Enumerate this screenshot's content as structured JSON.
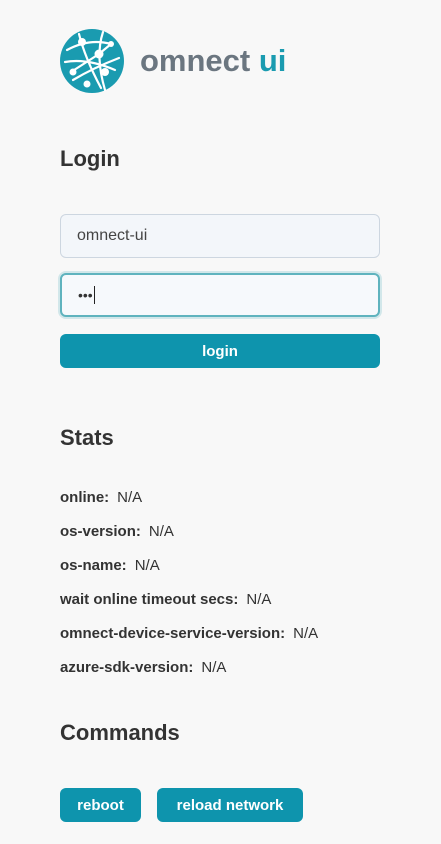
{
  "brand": {
    "name": "omnect",
    "accent": "ui",
    "logo_icon": "globe-network-icon",
    "colors": {
      "accent": "#1a9bb0",
      "name": "#6b7680"
    }
  },
  "login": {
    "title": "Login",
    "username_value": "omnect-ui",
    "password_mask": "•••",
    "button_label": "login"
  },
  "stats": {
    "title": "Stats",
    "items": [
      {
        "key": "online:",
        "value": "N/A"
      },
      {
        "key": "os-version:",
        "value": "N/A"
      },
      {
        "key": "os-name:",
        "value": "N/A"
      },
      {
        "key": "wait online timeout secs:",
        "value": "N/A"
      },
      {
        "key": "omnect-device-service-version:",
        "value": "N/A"
      },
      {
        "key": "azure-sdk-version:",
        "value": "N/A"
      }
    ]
  },
  "commands": {
    "title": "Commands",
    "reboot_label": "reboot",
    "reload_label": "reload network"
  },
  "theme": {
    "button_bg": "#0e94ad",
    "background": "#f8f8f8"
  }
}
